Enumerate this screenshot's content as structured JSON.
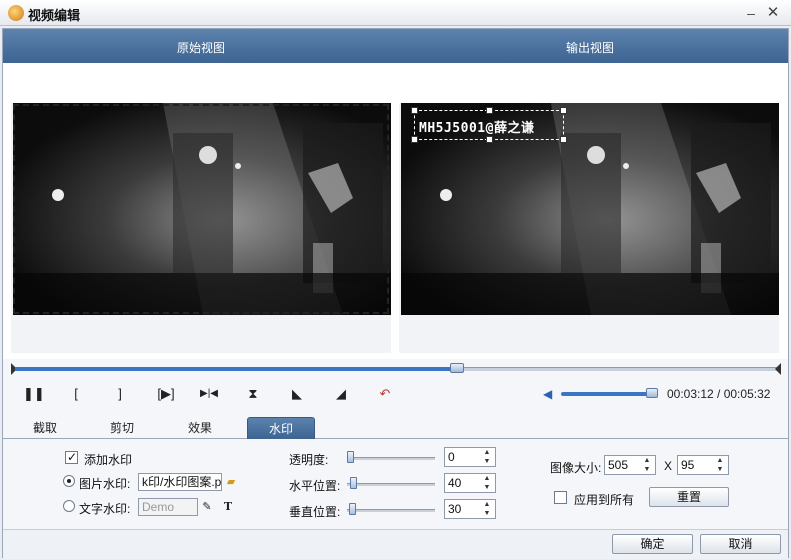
{
  "window": {
    "title": "视频编辑",
    "minimize_label": "–",
    "close_label": "✕"
  },
  "preview": {
    "left_label": "原始视图",
    "right_label": "输出视图",
    "watermark_text": "MH5J5001@薛之谦"
  },
  "playback": {
    "progress": 0.58,
    "volume": 0.95,
    "time_current": "00:03:12",
    "time_total": "00:05:32",
    "time_text": "00:03:12 / 00:05:32",
    "buttons": [
      {
        "name": "pause-button",
        "glyph": "❚❚"
      },
      {
        "name": "mark-in-button",
        "glyph": "["
      },
      {
        "name": "mark-out-button",
        "glyph": "]"
      },
      {
        "name": "play-segment-button",
        "glyph": "[▶]"
      },
      {
        "name": "next-frame-button",
        "glyph": "▶|◀"
      },
      {
        "name": "flip-vertical-button",
        "glyph": "⧗"
      },
      {
        "name": "rotate-right-button",
        "glyph": "◣"
      },
      {
        "name": "rotate-left-button",
        "glyph": "◢"
      },
      {
        "name": "undo-button",
        "glyph": "↶"
      }
    ]
  },
  "tabs": [
    {
      "label": "截取",
      "active": false
    },
    {
      "label": "剪切",
      "active": false
    },
    {
      "label": "效果",
      "active": false
    },
    {
      "label": "水印",
      "active": true
    }
  ],
  "watermark": {
    "add_label": "添加水印",
    "add_checked": true,
    "image_label": "图片水印:",
    "image_path": "k印/水印图案.p",
    "image_selected": true,
    "text_label": "文字水印:",
    "text_placeholder": "Demo"
  },
  "adjust": {
    "opacity_label": "透明度:",
    "opacity_value": "0",
    "h_label": "水平位置:",
    "h_value": "40",
    "v_label": "垂直位置:",
    "v_value": "30"
  },
  "size": {
    "label": "图像大小:",
    "width": "505",
    "x_label": "X",
    "height": "95",
    "apply_all_label": "应用到所有",
    "apply_all_checked": false,
    "reset_label": "重置"
  },
  "footer": {
    "ok_label": "确定",
    "cancel_label": "取消"
  }
}
